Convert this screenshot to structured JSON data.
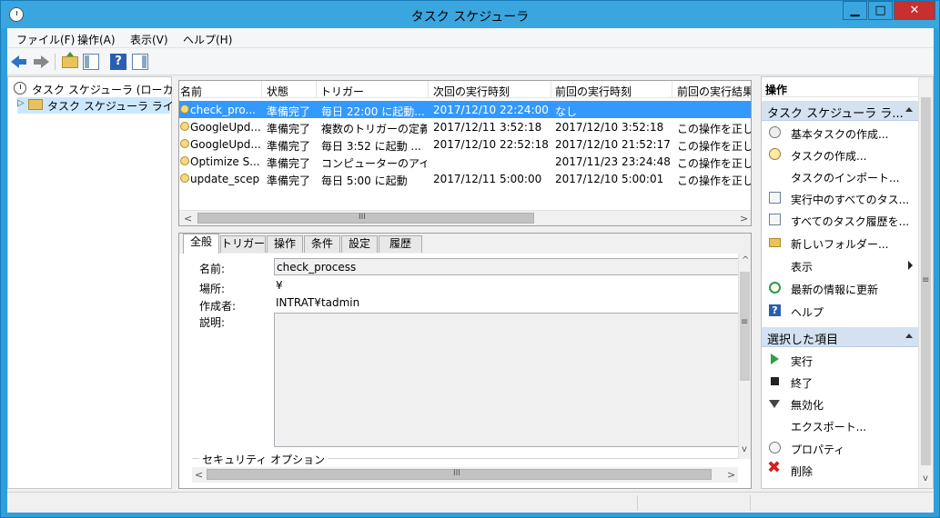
{
  "window": {
    "title": "タスク スケジューラ",
    "minimize": "▁",
    "maximize": "□",
    "close": "✕"
  },
  "menu": [
    "ファイル(F)",
    "操作(A)",
    "表示(V)",
    "ヘルプ(H)"
  ],
  "toolbar": {
    "help": "?"
  },
  "tree": {
    "root": "タスク スケジューラ (ローカル)",
    "library": "タスク スケジューラ ライブラリ",
    "expander": "▷"
  },
  "tasklist": {
    "headers": [
      "名前",
      "状態",
      "トリガー",
      "次回の実行時刻",
      "前回の実行時刻",
      "前回の実行結果"
    ],
    "rows": [
      [
        "check_pro...",
        "準備完了",
        "毎日 22:00 に起動...",
        "2017/12/10 22:24:00",
        "なし",
        ""
      ],
      [
        "GoogleUpd...",
        "準備完了",
        "複数のトリガーの定義",
        "2017/12/11 3:52:18",
        "2017/12/10 3:52:18",
        "この操作を正しく"
      ],
      [
        "GoogleUpd...",
        "準備完了",
        "毎日 3:52 に起動 ...",
        "2017/12/10 22:52:18",
        "2017/12/10 21:52:17",
        "この操作を正しく"
      ],
      [
        "Optimize S...",
        "準備完了",
        "コンピューターのアイド...",
        "",
        "2017/11/23 23:24:48",
        "この操作を正しく"
      ],
      [
        "update_scep",
        "準備完了",
        "毎日 5:00 に起動",
        "2017/12/11 5:00:00",
        "2017/12/10 5:00:01",
        "この操作を正しく"
      ]
    ],
    "scroll_left": "<",
    "scroll_right": ">",
    "scroll_grip": "III"
  },
  "details": {
    "tabs": [
      "全般",
      "トリガー",
      "操作",
      "条件",
      "設定",
      "履歴"
    ],
    "labels": {
      "name": "名前:",
      "location": "場所:",
      "author": "作成者:",
      "description": "説明:"
    },
    "values": {
      "name": "check_process",
      "location": "¥",
      "author": "INTRAT¥tadmin",
      "description": ""
    },
    "security_group": "セキュリティ オプション",
    "scroll_left": "<",
    "scroll_right": ">",
    "scroll_grip": "III",
    "vscroll_up": "^",
    "vscroll_down": "v",
    "vscroll_grip": "≡"
  },
  "actions": {
    "header": "操作",
    "group1": "タスク スケジューラ ラ...",
    "group1_items": [
      "基本タスクの作成...",
      "タスクの作成...",
      "タスクのインポート...",
      "実行中のすべてのタス...",
      "すべてのタスク履歴を...",
      "新しいフォルダー...",
      "表示",
      "最新の情報に更新",
      "ヘルプ"
    ],
    "group2": "選択した項目",
    "group2_items": [
      "実行",
      "終了",
      "無効化",
      "エクスポート...",
      "プロパティ",
      "削除"
    ],
    "help_glyph": "?",
    "delete_glyph": "✖",
    "scroll_grip": "≡",
    "scroll_down": "v"
  }
}
